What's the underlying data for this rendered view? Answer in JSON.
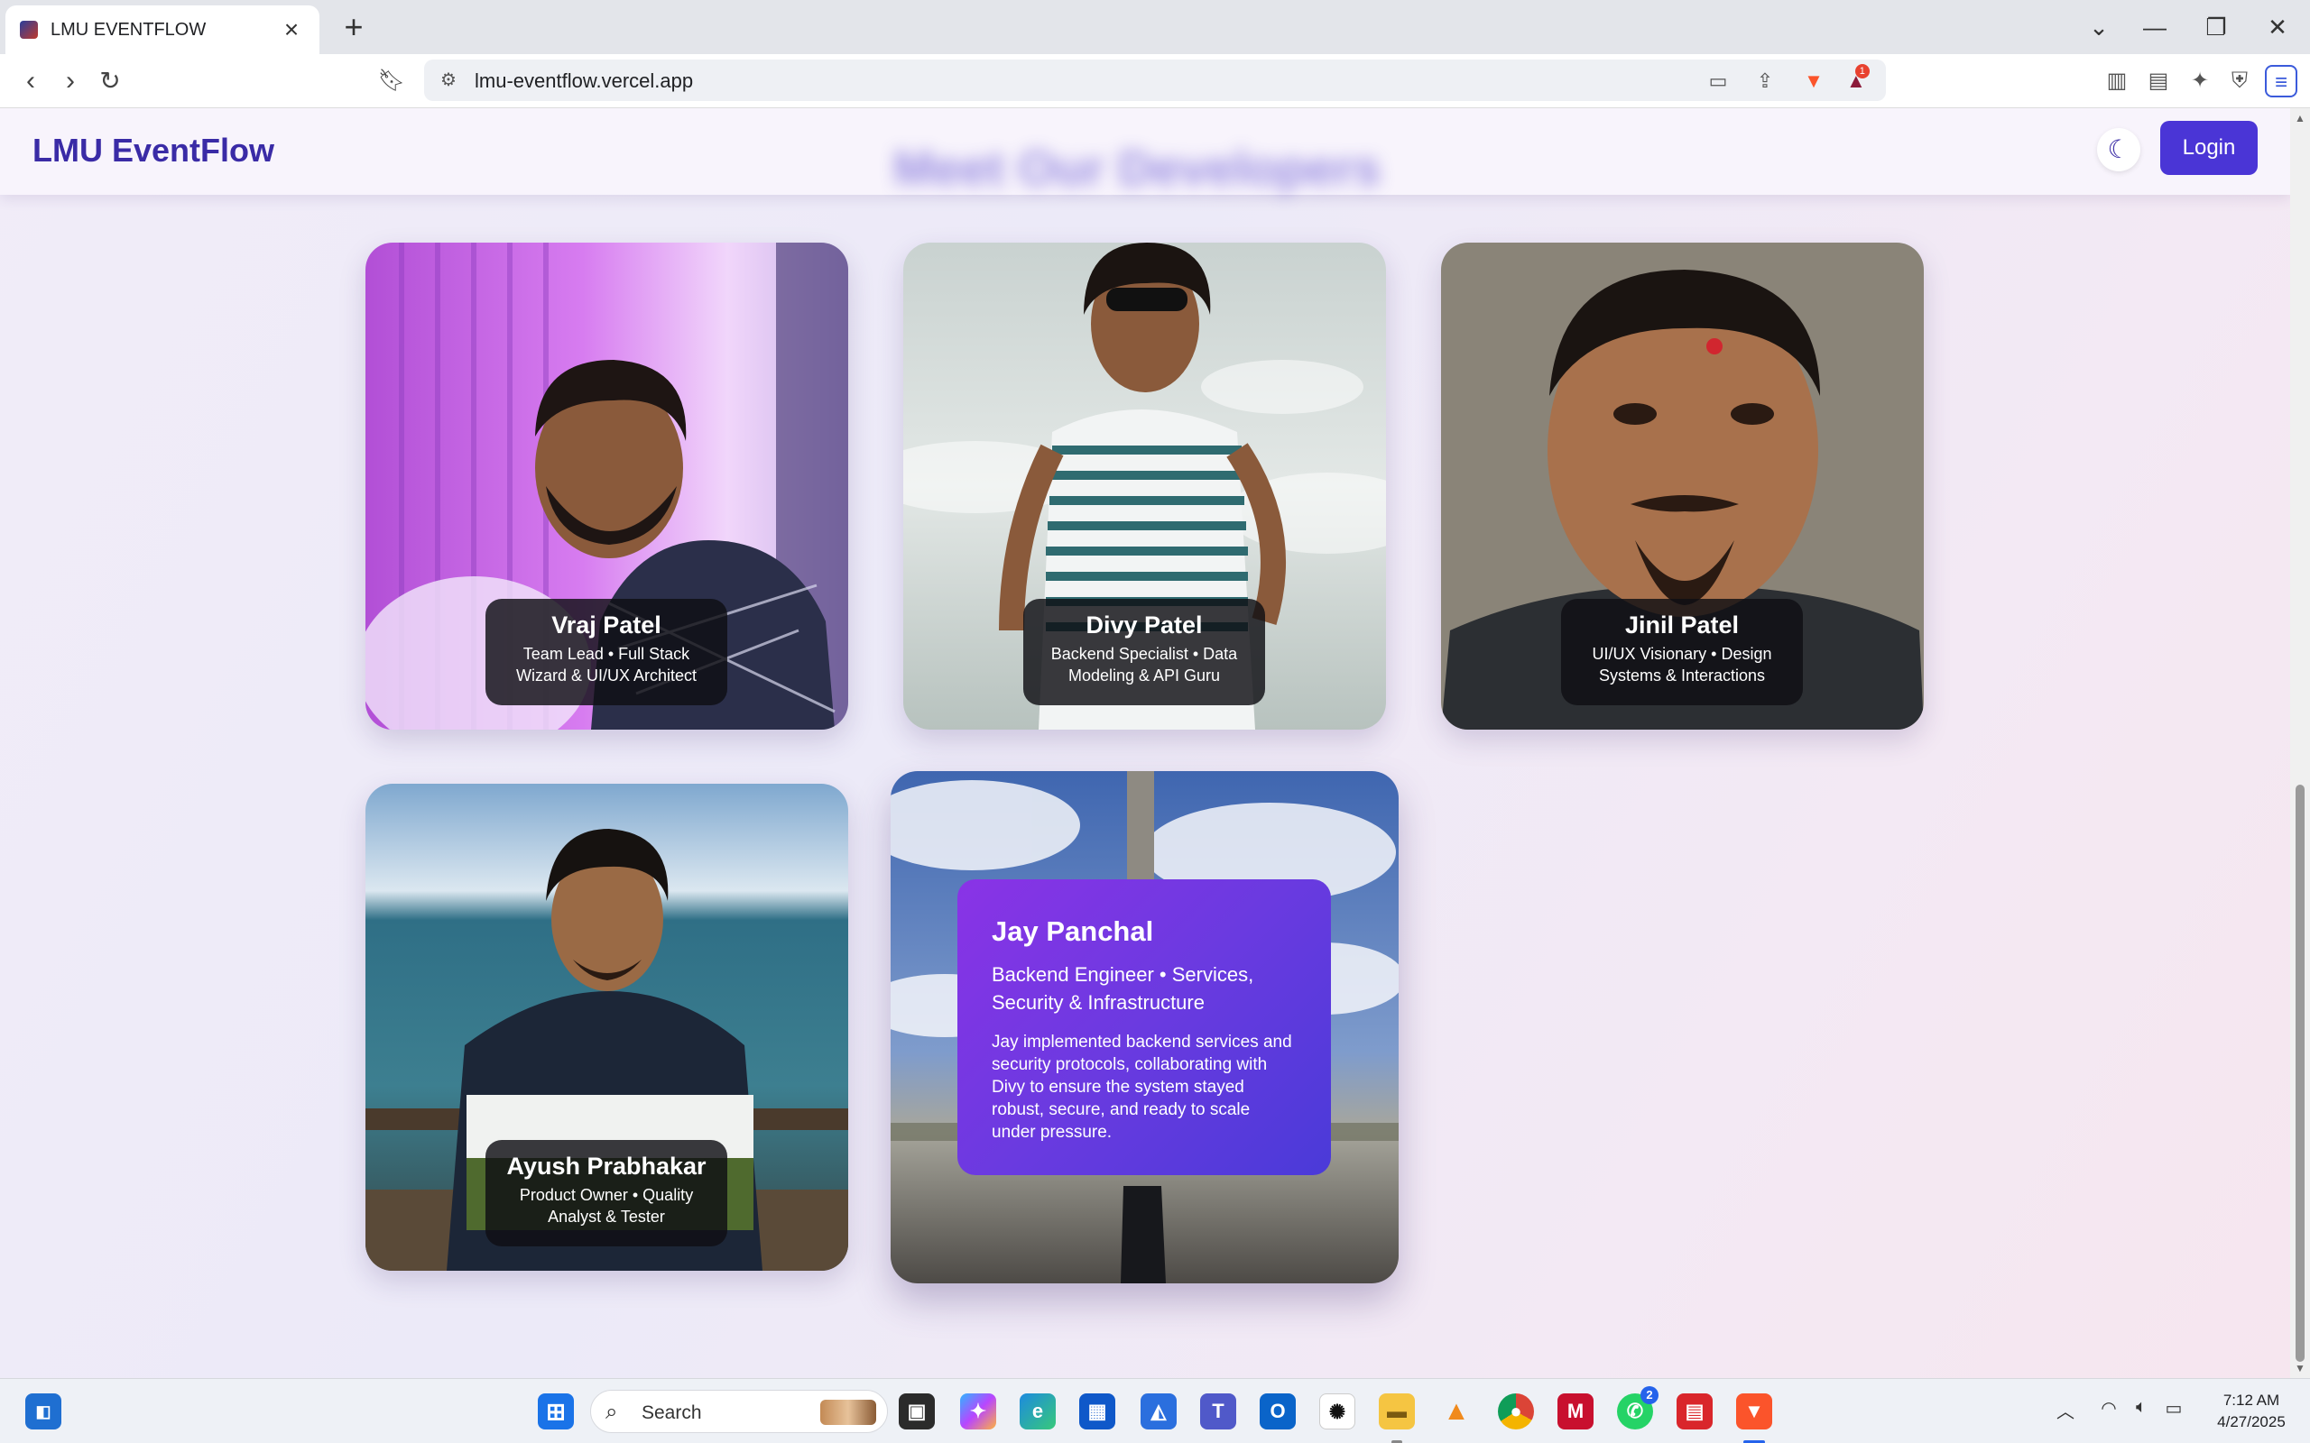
{
  "browser": {
    "tab_title": "LMU EVENTFLOW",
    "url": "lmu-eventflow.vercel.app",
    "rewards_badge": "1"
  },
  "header": {
    "brand": "LMU EventFlow",
    "login_label": "Login",
    "blurred_heading": "Meet Our Developers"
  },
  "team": [
    {
      "name": "Vraj Patel",
      "role": "Team Lead • Full Stack Wizard & UI/UX Architect"
    },
    {
      "name": "Divy Patel",
      "role": "Backend Specialist • Data Modeling & API Guru"
    },
    {
      "name": "Jinil Patel",
      "role": "UI/UX Visionary • Design Systems & Interactions"
    },
    {
      "name": "Ayush Prabhakar",
      "role": "Product Owner • Quality Analyst & Tester"
    },
    {
      "name": "Jay Panchal",
      "role": "Backend Engineer • Services, Security & Infrastructure",
      "description": "Jay implemented backend services and security protocols, collaborating with Divy to ensure the system stayed robust, secure, and ready to scale under pressure."
    }
  ],
  "taskbar": {
    "search_placeholder": "Search",
    "whatsapp_badge": "2",
    "time": "7:12 AM",
    "date": "4/27/2025"
  },
  "colors": {
    "brand": "#3a2ba6",
    "login": "#4a35d6",
    "overlay_start": "#8a33e6",
    "overlay_end": "#4a3ad8"
  }
}
